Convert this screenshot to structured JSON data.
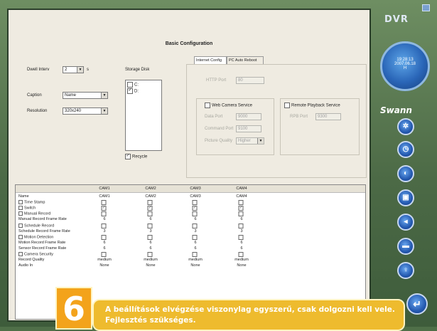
{
  "app": {
    "brand": "DVR",
    "clock_time": "19:28:13",
    "clock_date": "2007.06.18",
    "clock_sub": "H",
    "vendor": "Swann"
  },
  "basic": {
    "title": "Basic Configuration",
    "dwell_label": "Dwell Interv",
    "dwell_value": "2",
    "dwell_unit": "s",
    "caption_label": "Caption",
    "caption_value": "Name",
    "resolution_label": "Resolution",
    "resolution_value": "320x240",
    "storage_label": "Storage Disk",
    "disks": [
      {
        "label": "C:",
        "checked": false
      },
      {
        "label": "D:",
        "checked": true
      }
    ],
    "recycle_label": "Recycle",
    "recycle_checked": true
  },
  "tabs": [
    {
      "label": "Internet Config"
    },
    {
      "label": "PC Auto Reboot"
    }
  ],
  "internet": {
    "http_port_label": "HTTP Port",
    "http_port_value": "80",
    "web_camera_label": "Web Camera Service",
    "remote_playback_label": "Remote Playback Service",
    "data_port_label": "Data Port",
    "data_port_value": "9000",
    "command_port_label": "Command Port",
    "command_port_value": "9100",
    "picture_quality_label": "Picture Quality",
    "picture_quality_value": "Higher",
    "rpb_port_label": "RPB Port",
    "rpb_port_value": "9300"
  },
  "grid": {
    "columns": [
      "CAM1",
      "CAM2",
      "CAM3",
      "CAM4"
    ],
    "rows": [
      {
        "label": "Name",
        "type": "text",
        "values": [
          "CAM1",
          "CAM2",
          "CAM3",
          "CAM4"
        ]
      },
      {
        "label": "Time Stamp",
        "type": "check",
        "values": [
          "",
          "",
          "",
          ""
        ]
      },
      {
        "label": "Switch",
        "type": "check",
        "values": [
          "✓",
          "✓",
          "✓",
          "✓"
        ]
      },
      {
        "label": "Manual Record",
        "type": "check",
        "values": [
          "",
          "",
          "",
          ""
        ]
      },
      {
        "label": "Manual Record Frame Rate",
        "type": "text",
        "values": [
          "6",
          "6",
          "6",
          "6"
        ]
      },
      {
        "label": "Schedule Record",
        "type": "check",
        "values": [
          "",
          "",
          "",
          ""
        ]
      },
      {
        "label": "Schedule Record Frame Rate",
        "type": "text",
        "values": [
          "3",
          "3",
          "3",
          "3"
        ]
      },
      {
        "label": "Motion Detection",
        "type": "check",
        "values": [
          "",
          "",
          "",
          ""
        ]
      },
      {
        "label": "Motion Record Frame Rate",
        "type": "text",
        "values": [
          "6",
          "6",
          "6",
          "6"
        ]
      },
      {
        "label": "Sensor Record Frame Rate",
        "type": "text",
        "values": [
          "6",
          "6",
          "6",
          "6"
        ]
      },
      {
        "label": "Camera Security",
        "type": "check",
        "values": [
          "",
          "",
          "",
          ""
        ]
      },
      {
        "label": "Record Quality",
        "type": "text",
        "values": [
          "medium",
          "medium",
          "medium",
          "medium"
        ]
      },
      {
        "label": "Audio In",
        "type": "text",
        "values": [
          "None",
          "None",
          "None",
          "None"
        ]
      }
    ]
  },
  "caption": {
    "number": "6",
    "text": "A beállítások elvégzése viszonylag egyszerű, csak dolgozni kell vele. Fejlesztés szükséges."
  },
  "colors": {
    "accent": "#2a66b8",
    "banner": "#eebb2e",
    "badge": "#f3a31b"
  }
}
